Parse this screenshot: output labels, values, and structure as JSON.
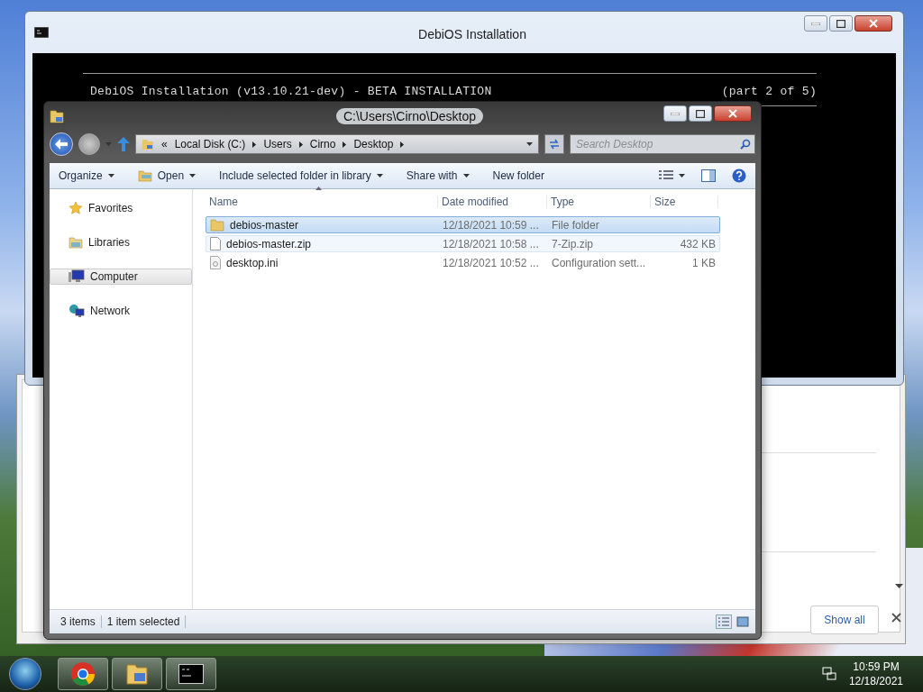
{
  "console_window": {
    "title": "DebiOS Installation",
    "header": "DebiOS Installation (v13.10.21-dev) - BETA INSTALLATION",
    "part": "(part 2 of 5)"
  },
  "explorer": {
    "title": "C:\\Users\\Cirno\\Desktop",
    "breadcrumb": [
      "«",
      "Local Disk (C:)",
      "Users",
      "Cirno",
      "Desktop"
    ],
    "search": {
      "placeholder": "Search Desktop"
    },
    "toolbar": [
      {
        "label": "Organize",
        "kind": "plain",
        "dropdown": true
      },
      {
        "label": "Open",
        "kind": "app",
        "dropdown": true
      },
      {
        "label": "Include selected folder in library",
        "kind": "plain",
        "dropdown": true
      },
      {
        "label": "Share with",
        "kind": "plain",
        "dropdown": true
      },
      {
        "label": "New folder",
        "kind": "plain",
        "dropdown": false
      }
    ],
    "nav": [
      {
        "label": "Favorites",
        "kind": "star",
        "selected": false
      },
      {
        "label": "Libraries",
        "kind": "library",
        "selected": false
      },
      {
        "label": "Computer",
        "kind": "computer",
        "selected": true
      },
      {
        "label": "Network",
        "kind": "network",
        "selected": false
      }
    ],
    "columns": [
      "Name",
      "Date modified",
      "Type",
      "Size"
    ],
    "rows": [
      {
        "kind": "folder",
        "name": "debios-master",
        "date": "12/18/2021 10:59 ...",
        "type": "File folder",
        "selected": true,
        "hovered": false
      },
      {
        "kind": "file",
        "name": "debios-master.zip",
        "date": "12/18/2021 10:58 ...",
        "type": "7-Zip.zip",
        "size": "432 KB",
        "selected": false,
        "hovered": true
      },
      {
        "kind": "config",
        "name": "desktop.ini",
        "date": "12/18/2021 10:52 ...",
        "type": "Configuration sett...",
        "size": "1 KB",
        "selected": false,
        "hovered": false
      }
    ],
    "status": [
      "3 items",
      "1 item selected"
    ]
  },
  "download_bar": {
    "button": "Show all"
  },
  "taskbar": {
    "time": "10:59 PM",
    "date": "12/18/2021"
  }
}
